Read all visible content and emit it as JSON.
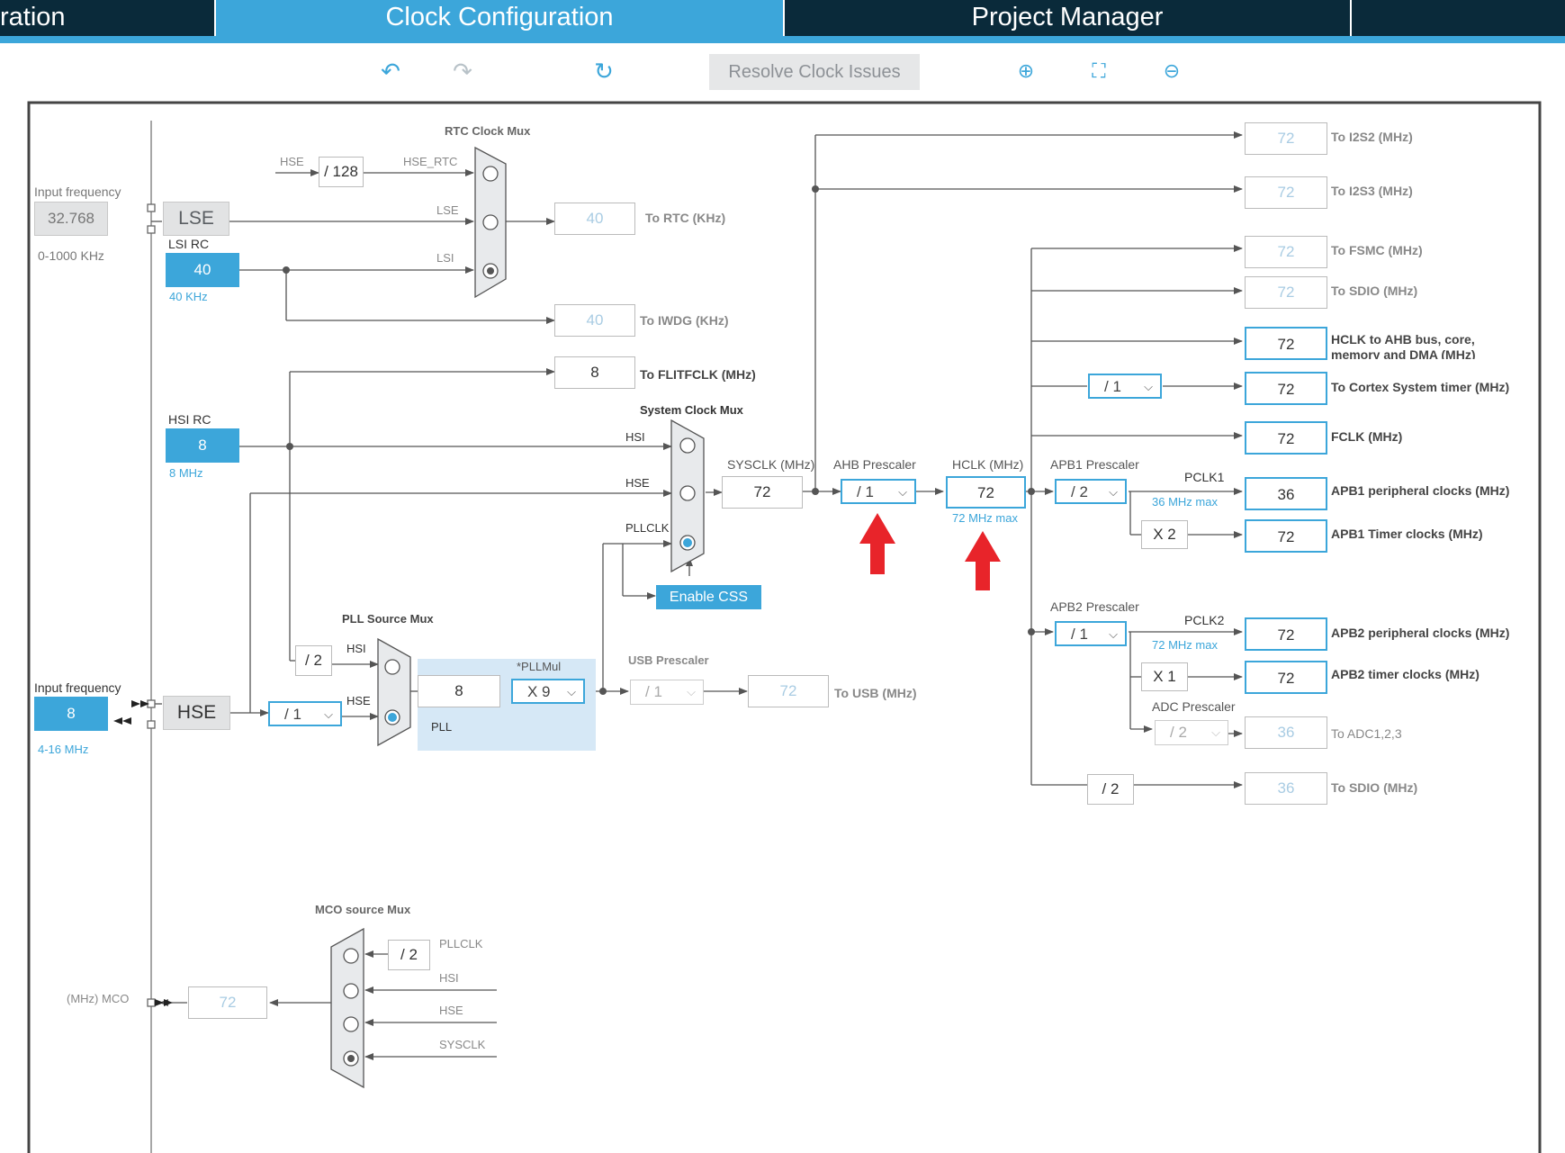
{
  "tabs": [
    "ration",
    "Clock Configuration",
    "Project Manager"
  ],
  "toolbar": {
    "resolve": "Resolve Clock Issues",
    "undo": "undo-icon",
    "redo": "redo-icon",
    "reset": "reset-icon",
    "zoom_in": "zoom-in-icon",
    "fit": "fit-icon",
    "zoom_out": "zoom-out-icon"
  },
  "lse": {
    "input_label": "Input frequency",
    "value": "32.768",
    "range": "0-1000 KHz",
    "name": "LSE"
  },
  "lsi": {
    "title": "LSI RC",
    "value": "40",
    "freq": "40 KHz"
  },
  "hsi": {
    "title": "HSI RC",
    "value": "8",
    "freq": "8 MHz"
  },
  "hse": {
    "input_label": "Input frequency",
    "value": "8",
    "range": "4-16 MHz",
    "name": "HSE",
    "div": "/ 1"
  },
  "rtc": {
    "title": "RTC Clock Mux",
    "hse_label": "HSE",
    "div": "/ 128",
    "hse_rtc": "HSE_RTC",
    "lse": "LSE",
    "lsi": "LSI",
    "out": "40",
    "out_label": "To RTC (KHz)"
  },
  "iwdg": {
    "out": "40",
    "label": "To IWDG (KHz)"
  },
  "flitf": {
    "out": "8",
    "label": "To FLITFCLK (MHz)"
  },
  "sysmux": {
    "title": "System Clock Mux",
    "hsi": "HSI",
    "hse": "HSE",
    "pllclk": "PLLCLK",
    "css": "Enable CSS"
  },
  "sysclk": {
    "label": "SYSCLK (MHz)",
    "value": "72"
  },
  "ahb": {
    "label": "AHB Prescaler",
    "value": "/ 1"
  },
  "hclk": {
    "label": "HCLK (MHz)",
    "value": "72",
    "max": "72 MHz max"
  },
  "pll_src": {
    "title": "PLL Source Mux",
    "div": "/ 2",
    "hsi": "HSI",
    "hse": "HSE"
  },
  "pll": {
    "mul_label": "*PLLMul",
    "value": "8",
    "mul": "X 9",
    "name": "PLL"
  },
  "usb": {
    "title": "USB Prescaler",
    "div": "/ 1",
    "out": "72",
    "label": "To USB (MHz)"
  },
  "apb1": {
    "label": "APB1 Prescaler",
    "value": "/ 2",
    "pclk": "PCLK1",
    "max": "36 MHz max",
    "timer_mul": "X 2"
  },
  "apb2": {
    "label": "APB2 Prescaler",
    "value": "/ 1",
    "pclk": "PCLK2",
    "max": "72 MHz max",
    "timer_mul": "X 1"
  },
  "adc": {
    "label": "ADC Prescaler",
    "div": "/ 2"
  },
  "cortex_div": "/ 1",
  "sdio_div": "/ 2",
  "outputs": [
    {
      "value": "72",
      "label": "To I2S2 (MHz)"
    },
    {
      "value": "72",
      "label": "To I2S3 (MHz)"
    },
    {
      "value": "72",
      "label": "To FSMC (MHz)"
    },
    {
      "value": "72",
      "label": "To SDIO (MHz)"
    },
    {
      "value": "72",
      "label": "HCLK to AHB bus, core, memory and DMA (MHz)"
    },
    {
      "value": "72",
      "label": "To Cortex System timer (MHz)"
    },
    {
      "value": "72",
      "label": "FCLK (MHz)"
    },
    {
      "value": "36",
      "label": "APB1 peripheral clocks (MHz)"
    },
    {
      "value": "72",
      "label": "APB1 Timer clocks (MHz)"
    },
    {
      "value": "72",
      "label": "APB2 peripheral clocks (MHz)"
    },
    {
      "value": "72",
      "label": "APB2 timer clocks (MHz)"
    },
    {
      "value": "36",
      "label": "To ADC1,2,3"
    },
    {
      "value": "36",
      "label": "To SDIO (MHz)"
    }
  ],
  "mco": {
    "title": "MCO source Mux",
    "div": "/ 2",
    "pllclk": "PLLCLK",
    "hsi": "HSI",
    "hse": "HSE",
    "sysclk": "SYSCLK",
    "out": "72",
    "label": "(MHz) MCO"
  }
}
